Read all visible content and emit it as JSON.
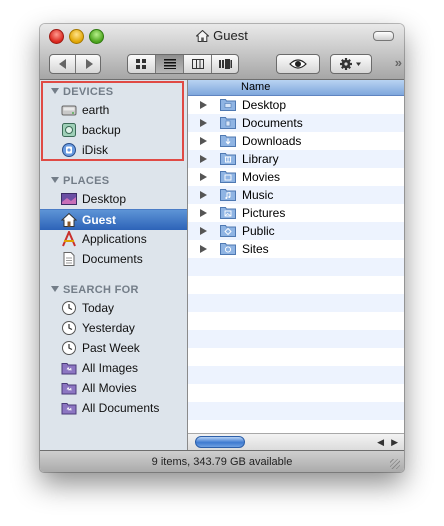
{
  "window": {
    "title": "Guest",
    "status_text": "9 items, 343.79 GB available"
  },
  "toolbar": {
    "back_icon": "left-arrow-icon",
    "forward_icon": "right-arrow-icon",
    "view_buttons": [
      "icon-view",
      "list-view",
      "column-view",
      "coverflow-view"
    ],
    "quicklook_icon": "eye-icon",
    "action_icon": "gear-icon"
  },
  "sidebar": {
    "devices_header": "DEVICES",
    "devices": [
      {
        "label": "earth",
        "icon": "disk-icon"
      },
      {
        "label": "backup",
        "icon": "external-disk-icon"
      },
      {
        "label": "iDisk",
        "icon": "idisk-icon"
      }
    ],
    "places_header": "PLACES",
    "places": [
      {
        "label": "Desktop",
        "icon": "desktop-icon"
      },
      {
        "label": "Guest",
        "icon": "home-icon"
      },
      {
        "label": "Applications",
        "icon": "applications-icon"
      },
      {
        "label": "Documents",
        "icon": "documents-icon"
      }
    ],
    "search_header": "SEARCH FOR",
    "searches": [
      {
        "label": "Today",
        "icon": "clock-icon"
      },
      {
        "label": "Yesterday",
        "icon": "clock-icon"
      },
      {
        "label": "Past Week",
        "icon": "clock-icon"
      },
      {
        "label": "All Images",
        "icon": "smart-folder-icon"
      },
      {
        "label": "All Movies",
        "icon": "smart-folder-icon"
      },
      {
        "label": "All Documents",
        "icon": "smart-folder-icon"
      }
    ]
  },
  "list": {
    "column_name": "Name",
    "items": [
      "Desktop",
      "Documents",
      "Downloads",
      "Library",
      "Movies",
      "Music",
      "Pictures",
      "Public",
      "Sites"
    ]
  },
  "colors": {
    "selection": "#3b72c4",
    "sidebar_bg": "#dde4eb",
    "highlight_box": "#e04a44",
    "folder_blue": "#7ea6d8"
  }
}
